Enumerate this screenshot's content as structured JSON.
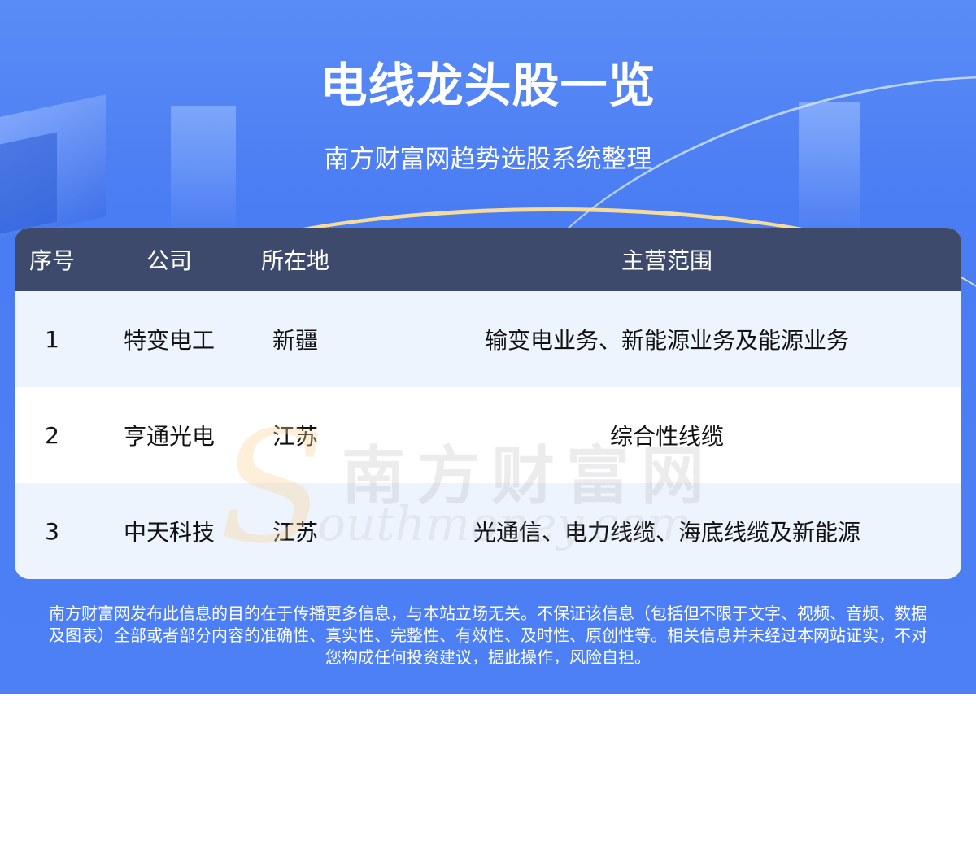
{
  "title": "电线龙头股一览",
  "subtitle": "南方财富网趋势选股系统整理",
  "table": {
    "headers": [
      "序号",
      "公司",
      "所在地",
      "主营范围"
    ],
    "rows": [
      {
        "seq": "1",
        "company": "特变电工",
        "location": "新疆",
        "business": "输变电业务、新能源业务及能源业务"
      },
      {
        "seq": "2",
        "company": "亨通光电",
        "location": "江苏",
        "business": "综合性线缆"
      },
      {
        "seq": "3",
        "company": "中天科技",
        "location": "江苏",
        "business": "光通信、电力线缆、海底线缆及新能源"
      }
    ]
  },
  "watermark": {
    "cn": "南方财富网",
    "en": "outhmoney.com",
    "s": "S"
  },
  "disclaimer": [
    "南方财富网发布此信息的目的在于传播更多信息，与本站立场无关。不保证该信息（包括但不限于文字、视频、音频、数据",
    "及图表）全部或者部分内容的准确性、真实性、完整性、有效性、及时性、原创性等。相关信息并未经过本网站证实，不对",
    "您构成任何投资建议，据此操作，风险自担。"
  ],
  "colors": {
    "banner": "#4a7cf3",
    "header": "#3d4a6b",
    "row_alt": "#eef4fd",
    "arc": "#ffe296"
  }
}
